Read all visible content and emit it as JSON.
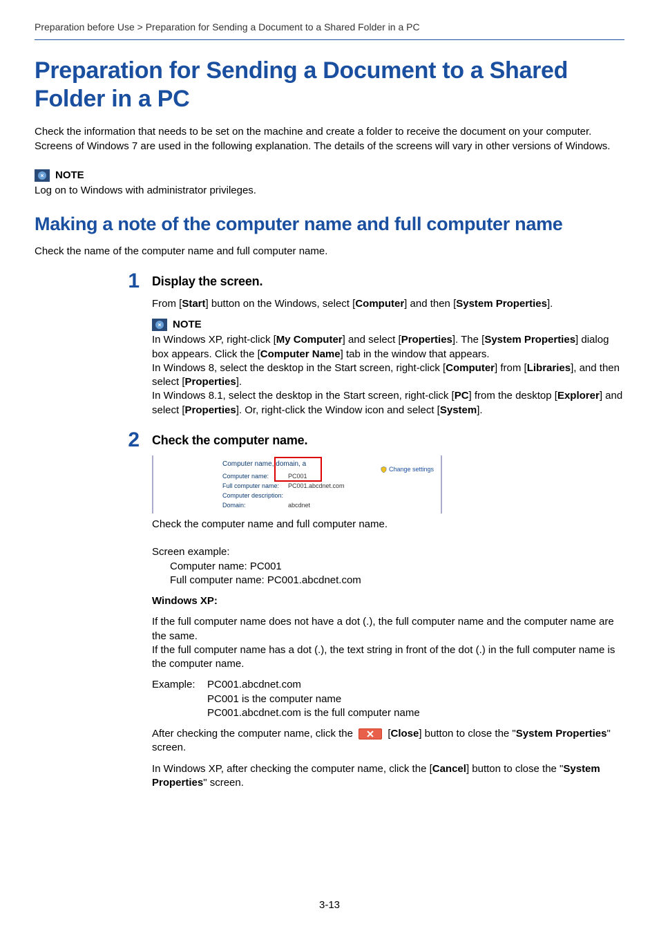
{
  "breadcrumb": "Preparation before Use > Preparation for Sending a Document to a Shared Folder in a PC",
  "title": "Preparation for Sending a Document to a Shared Folder in a PC",
  "intro": "Check the information that needs to be set on the machine and create a folder to receive the document on your computer. Screens of Windows 7 are used in the following explanation. The details of the screens will vary in other versions of Windows.",
  "note_label": "NOTE",
  "note_body": "Log on to Windows with administrator privileges.",
  "section_title": "Making a note of the computer name and full computer name",
  "section_intro": "Check the name of the computer name and full computer name.",
  "step1": {
    "num": "1",
    "title": "Display the screen.",
    "line_pre": "From [",
    "start": "Start",
    "line_mid1": "] button on the Windows, select [",
    "computer": "Computer",
    "line_mid2": "] and then [",
    "sysprops": "System Properties",
    "line_end": "].",
    "note_xp_1": "In Windows XP, right-click [",
    "mycomputer": "My Computer",
    "note_xp_2": "] and select [",
    "properties": "Properties",
    "note_xp_3": "]. The [",
    "note_xp_4": "] dialog box appears. Click the [",
    "compname_tab": "Computer Name",
    "note_xp_5": "] tab in the window that appears.",
    "note_8_1": "In Windows 8, select the desktop in the Start screen, right-click [",
    "note_8_2": "] from [",
    "libraries": "Libraries",
    "note_8_3": "], and then select [",
    "note_8_4": "].",
    "note_81_1": "In Windows 8.1, select the desktop in the Start screen, right-click [",
    "pc": "PC",
    "note_81_2": "] from the desktop [",
    "explorer": "Explorer",
    "note_81_3": "] and select [",
    "note_81_4": "]. Or, right-click the Window icon and select [",
    "system": "System",
    "note_81_5": "]."
  },
  "step2": {
    "num": "2",
    "title": "Check the computer name.",
    "ss": {
      "heading": "Computer name, domain, a",
      "row1_label": "Computer name:",
      "row1_val": "PC001",
      "row2_label": "Full computer name:",
      "row2_val": "PC001.abcdnet.com",
      "row3_label": "Computer description:",
      "row3_val": "",
      "row4_label": "Domain:",
      "row4_val": "abcdnet",
      "change": "Change settings"
    },
    "after_ss": "Check the computer name and full computer name.",
    "screen_example_label": "Screen example:",
    "ex_line1": "Computer name: PC001",
    "ex_line2": "Full computer name: PC001.abcdnet.com",
    "winxp_label": "Windows XP:",
    "xp_para1": "If the full computer name does not have a dot (.), the full computer name and the computer name are the same.",
    "xp_para2": "If the full computer name has a dot (.), the text string in front of the dot (.) in the full computer name is the computer name.",
    "example_label": "Example:",
    "example_l1": "PC001.abcdnet.com",
    "example_l2": "PC001 is the computer name",
    "example_l3": "PC001.abcdnet.com is the full computer name",
    "close_pre": "After checking the computer name, click the ",
    "close_mid": " [",
    "close_btn": "Close",
    "close_post1": "] button to close the \"",
    "close_post2": "\" screen.",
    "xp_close_pre": "In Windows XP, after checking the computer name, click the [",
    "cancel": "Cancel",
    "xp_close_mid": "] button to close the \"",
    "xp_close_end": "\" screen."
  },
  "page_number": "3-13"
}
